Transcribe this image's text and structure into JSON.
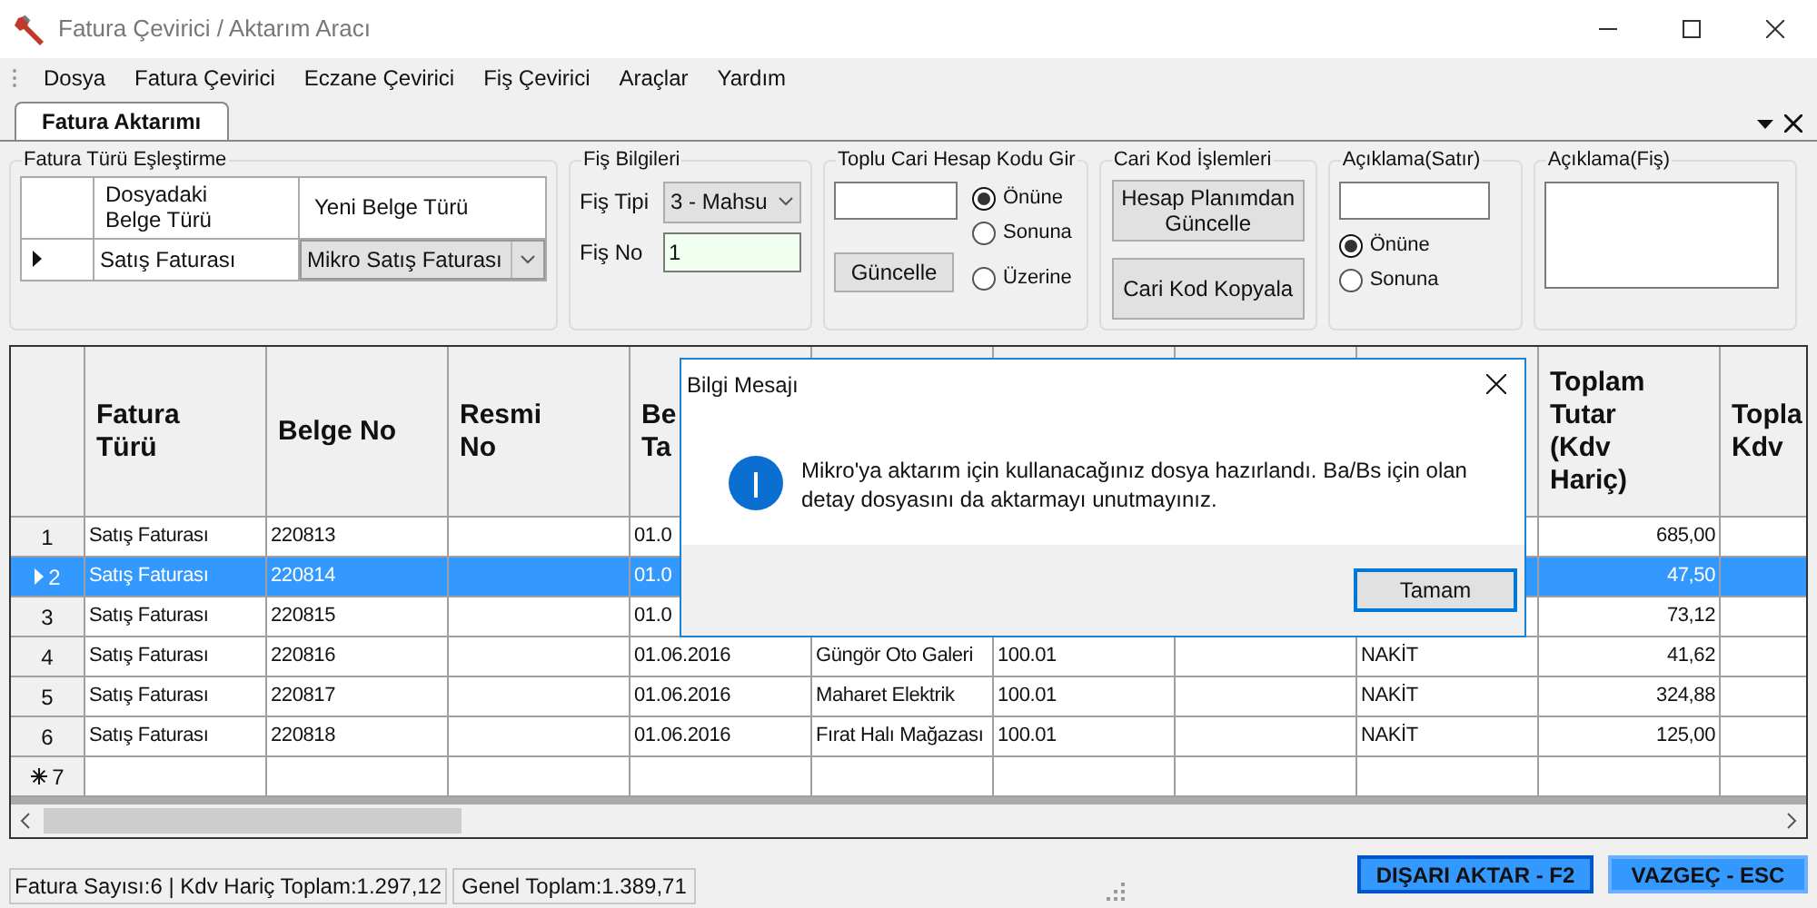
{
  "window": {
    "title": "Fatura Çevirici / Aktarım Aracı"
  },
  "menu": [
    "Dosya",
    "Fatura Çevirici",
    "Eczane Çevirici",
    "Fiş Çevirici",
    "Araçlar",
    "Yardım"
  ],
  "tabs": [
    {
      "label": "Fatura Aktarımı",
      "selected": true
    }
  ],
  "type_mapping": {
    "title": "Fatura Türü Eşleştirme",
    "columns": [
      "Dosyadaki\nBelge Türü",
      "Yeni Belge Türü"
    ],
    "rows": [
      {
        "current": true,
        "source": "Satış Faturası",
        "target": "Mikro Satış Faturası"
      }
    ]
  },
  "fis_info": {
    "title": "Fiş Bilgileri",
    "type_label": "Fiş Tipi",
    "type_value": "3 - Mahsu",
    "no_label": "Fiş No",
    "no_value": "1"
  },
  "bulk_account": {
    "title": "Toplu Cari Hesap Kodu Gir",
    "button": "Güncelle",
    "options": [
      {
        "label": "Önüne",
        "selected": true
      },
      {
        "label": "Sonuna",
        "selected": false
      },
      {
        "label": "Üzerine",
        "selected": false
      }
    ]
  },
  "account_ops": {
    "title": "Cari Kod İşlemleri",
    "buttons": [
      "Hesap Planımdan\nGüncelle",
      "Cari Kod Kopyala"
    ]
  },
  "line_note": {
    "title": "Açıklama(Satır)",
    "options": [
      {
        "label": "Önüne",
        "selected": true
      },
      {
        "label": "Sonuna",
        "selected": false
      }
    ]
  },
  "voucher_note": {
    "title": "Açıklama(Fiş)"
  },
  "table": {
    "columns": [
      "Fatura\nTürü",
      "Belge No",
      "Resmi\nNo",
      "Be\nTa",
      null,
      null,
      null,
      null,
      "Toplam\nTutar\n(Kdv\nHariç)",
      "Topla\nKdv"
    ],
    "rows": [
      {
        "header": "1",
        "selected": false,
        "new": false,
        "cells": [
          "Satış Faturası",
          "220813",
          null,
          "01.0",
          null,
          null,
          null,
          null,
          "685,00",
          null
        ]
      },
      {
        "header": "2",
        "selected": true,
        "new": false,
        "cells": [
          "Satış Faturası",
          "220814",
          null,
          "01.0",
          null,
          null,
          null,
          null,
          "47,50",
          null
        ]
      },
      {
        "header": "3",
        "selected": false,
        "new": false,
        "cells": [
          "Satış Faturası",
          "220815",
          null,
          "01.0",
          null,
          null,
          null,
          null,
          "73,12",
          null
        ]
      },
      {
        "header": "4",
        "selected": false,
        "new": false,
        "cells": [
          "Satış Faturası",
          "220816",
          null,
          "01.06.2016",
          "Güngör Oto Galeri",
          "100.01",
          null,
          "NAKİT",
          "41,62",
          null
        ]
      },
      {
        "header": "5",
        "selected": false,
        "new": false,
        "cells": [
          "Satış Faturası",
          "220817",
          null,
          "01.06.2016",
          "Maharet Elektrik",
          "100.01",
          null,
          "NAKİT",
          "324,88",
          null
        ]
      },
      {
        "header": "6",
        "selected": false,
        "new": false,
        "cells": [
          "Satış Faturası",
          "220818",
          null,
          "01.06.2016",
          "Fırat Halı Mağazası",
          "100.01",
          null,
          "NAKİT",
          "125,00",
          null
        ]
      },
      {
        "header": "7",
        "selected": false,
        "new": true,
        "cells": [
          null,
          null,
          null,
          null,
          null,
          null,
          null,
          null,
          null,
          null
        ]
      }
    ]
  },
  "status": [
    "Fatura Sayısı:6 | Kdv Hariç Toplam:1.297,12",
    "Genel Toplam:1.389,71"
  ],
  "actions": [
    "DIŞARI AKTAR - F2",
    "VAZGEÇ - ESC"
  ],
  "dialog": {
    "title": "Bilgi Mesajı",
    "message": "Mikro'ya aktarım için kullanacağınız dosya hazırlandı. Ba/Bs için olan detay dosyasını da aktarmayı unutmayınız.",
    "button": "Tamam"
  }
}
